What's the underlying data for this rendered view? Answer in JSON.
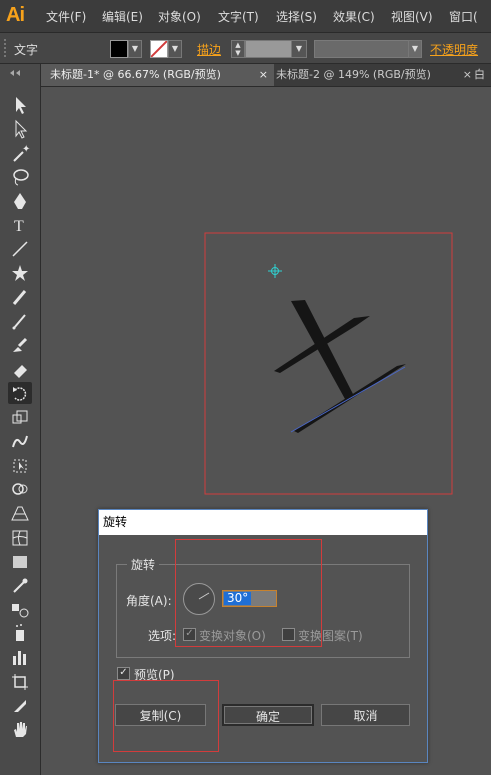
{
  "app": {
    "logo": "Ai"
  },
  "menu": [
    "文件(F)",
    "编辑(E)",
    "对象(O)",
    "文字(T)",
    "选择(S)",
    "效果(C)",
    "视图(V)",
    "窗口("
  ],
  "control_bar": {
    "tool_name": "文字",
    "stroke_label": "描边",
    "opacity_label": "不透明度"
  },
  "tabs": [
    {
      "label": "未标题-1* @ 66.67% (RGB/预览)",
      "close": "×"
    },
    {
      "label": "未标题-2 @ 149% (RGB/预览)",
      "close": "×"
    },
    {
      "label": "白"
    }
  ],
  "colors": {
    "accent": "#f7a21b",
    "selection": "#d23c3c",
    "dialog_border": "#5a86c0",
    "highlight": "#1f6fd6"
  },
  "dialog": {
    "title": "旋转",
    "group_label": "旋转",
    "angle_label": "角度(A):",
    "angle_value": "30°",
    "options_label": "选项:",
    "transform_objects": "变换对象(O)",
    "transform_patterns": "变换图案(T)",
    "preview": "预览(P)",
    "copy_button": "复制(C)",
    "ok_button": "确定",
    "cancel_button": "取消"
  },
  "tools": [
    "selection-icon",
    "direct-selection-icon",
    "magic-wand-icon",
    "lasso-icon",
    "pen-icon",
    "type-icon",
    "line-icon",
    "star-icon",
    "paintbrush-icon",
    "pencil-icon",
    "blob-brush-icon",
    "eraser-icon",
    "rotate-icon",
    "scale-icon",
    "warp-icon",
    "free-transform-icon",
    "shape-builder-icon",
    "perspective-grid-icon",
    "mesh-icon",
    "gradient-icon",
    "eyedropper-icon",
    "blend-icon",
    "symbol-sprayer-icon",
    "column-graph-icon",
    "artboard-icon",
    "slice-icon",
    "hand-icon"
  ]
}
